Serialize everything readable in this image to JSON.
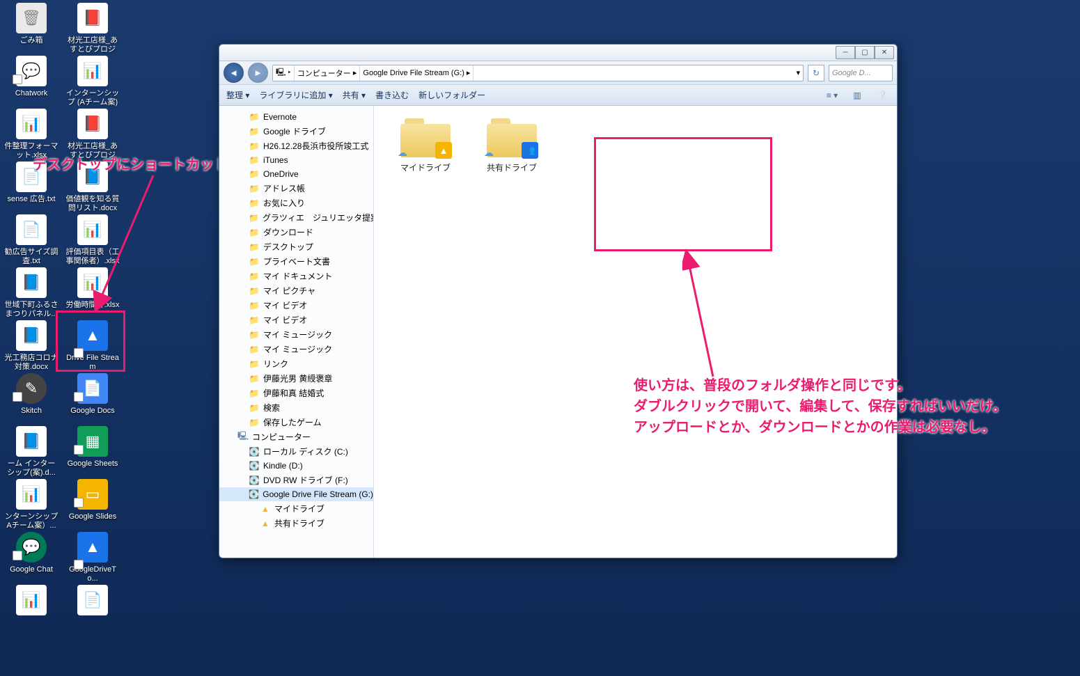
{
  "desktop_icons": {
    "r0c0": "ごみ箱",
    "r0c1": "材光工店様_あすとびプロジェ...",
    "r1c0": "Chatwork",
    "r1c1": "インターンシップ (Aチーム案) ...",
    "r2c0": "件整理フォーマット.xlsx",
    "r2c1": "材光工店様_あすとびプロジェ...",
    "r3c0": "sense 広告.txt",
    "r3c1": "価値観を知る質問リスト.docx",
    "r4c0": "勧広告サイズ調査.txt",
    "r4c1": "評価項目表（工事関係者）.xlsx",
    "r5c0": "世域下町ふるさまつりパネル...",
    "r5c1": "労働時間計.xlsx",
    "r6c0": "光工務店コロナ対策.docx",
    "r6c1": "Drive File Stream",
    "r7c0": "Skitch",
    "r7c1": "Google Docs",
    "r8c0": "ーム インターシップ(案).d...",
    "r8c1": "Google Sheets",
    "r9c0": "ンターンシップAチーム案）...",
    "r9c1": "Google Slides",
    "r10c0": "Google Chat",
    "r10c1": "GoogleDriveTo..."
  },
  "annotation1": "デスクトップにショートカットができます。",
  "annotation2_l1": "使い方は、普段のフォルダ操作と同じです。",
  "annotation2_l2": "ダブルクリックで開いて、編集して、保存すればいいだけ。",
  "annotation2_l3": "アップロードとか、ダウンロードとかの作業は必要なし。",
  "window": {
    "breadcrumb": {
      "a": "コンピューター",
      "b": "Google Drive File Stream (G:)"
    },
    "search_placeholder": "Google D...",
    "toolbar": {
      "organize": "整理 ▾",
      "library": "ライブラリに追加 ▾",
      "share": "共有 ▾",
      "burn": "書き込む",
      "newfolder": "新しいフォルダー"
    },
    "tree": [
      {
        "t": "Evernote",
        "i": "folder"
      },
      {
        "t": "Google ドライブ",
        "i": "folder"
      },
      {
        "t": "H26.12.28長浜市役所竣工式",
        "i": "folder"
      },
      {
        "t": "iTunes",
        "i": "folder"
      },
      {
        "t": "OneDrive",
        "i": "folder"
      },
      {
        "t": "アドレス帳",
        "i": "folder"
      },
      {
        "t": "お気に入り",
        "i": "folder"
      },
      {
        "t": "グラツィエ　ジュリエッタ提案",
        "i": "folder"
      },
      {
        "t": "ダウンロード",
        "i": "folder"
      },
      {
        "t": "デスクトップ",
        "i": "folder"
      },
      {
        "t": "プライベート文書",
        "i": "folder"
      },
      {
        "t": "マイ ドキュメント",
        "i": "folder"
      },
      {
        "t": "マイ ピクチャ",
        "i": "folder"
      },
      {
        "t": "マイ ビデオ",
        "i": "folder"
      },
      {
        "t": "マイ ビデオ",
        "i": "folder"
      },
      {
        "t": "マイ ミュージック",
        "i": "folder"
      },
      {
        "t": "マイ ミュージック",
        "i": "folder"
      },
      {
        "t": "リンク",
        "i": "folder"
      },
      {
        "t": "伊藤光男 黄綬褒章",
        "i": "folder"
      },
      {
        "t": "伊藤和真 結婚式",
        "i": "folder"
      },
      {
        "t": "検索",
        "i": "folder"
      },
      {
        "t": "保存したゲーム",
        "i": "folder"
      }
    ],
    "tree_computer": "コンピューター",
    "tree_drives": [
      {
        "t": "ローカル ディスク (C:)"
      },
      {
        "t": "Kindle (D:)"
      },
      {
        "t": "DVD RW ドライブ (F:)"
      },
      {
        "t": "Google Drive File Stream (G:)",
        "sel": true
      }
    ],
    "tree_sub": [
      {
        "t": "マイドライブ"
      },
      {
        "t": "共有ドライブ"
      }
    ],
    "folders": [
      {
        "label": "マイドライブ",
        "badge_color": "#f4b400",
        "badge_glyph": "▲"
      },
      {
        "label": "共有ドライブ",
        "badge_color": "#1a73e8",
        "badge_glyph": "👥"
      }
    ]
  }
}
